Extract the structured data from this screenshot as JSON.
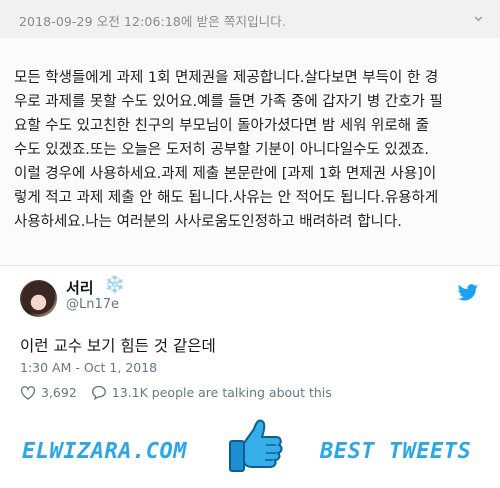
{
  "header": {
    "timestamp": "2018-09-29 오전 12:06:18에 받은 쪽지입니다.",
    "more_icon": "chevron-down-icon"
  },
  "message": {
    "body": "모든 학생들에게 과제 1회 면제권을 제공합니다.살다보면 부득이 한 경\n우로 과제를 못할 수도 있어요.예를 들면 가족 중에 갑자기 병 간호가 필\n요할 수도 있고친한 친구의 부모님이 돌아가셨다면 밤 세워 위로해 줄\n수도 있겠죠.또는 오늘은 도저히 공부할 기분이 아니다일수도 있겠죠.\n이럴 경우에 사용하세요.과제 제출 본문란에 [과제 1화 면제권 사용]이\n렇게 적고 과제 제출 안 해도 됩니다.사유는 안 적어도 됩니다.유용하게\n사용하세요.나는 여러분의 사사로움도인정하고 배려하려 합니다."
  },
  "tweet": {
    "name": "서리",
    "name_emoji": "❄️",
    "handle": "@Ln17e",
    "text": "이런 교수 보기 힘든 것 같은데",
    "time": "1:30 AM - Oct 1, 2018",
    "likes": "3,692",
    "talking": "13.1K people are talking about this",
    "brand_icon": "twitter-bird-icon",
    "colors": {
      "twitter_blue": "#1da1f2",
      "muted": "#657786"
    }
  },
  "footer": {
    "site": "ELWIZARA.COM",
    "tagline": "BEST TWEETS",
    "accent": "#2fa7e6"
  }
}
